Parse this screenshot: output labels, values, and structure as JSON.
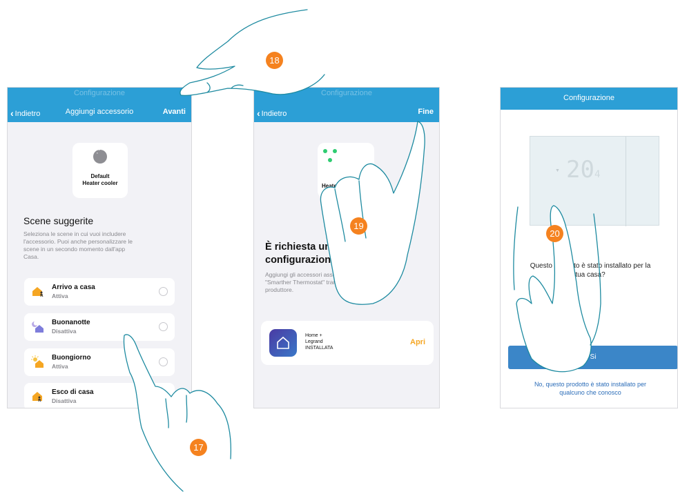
{
  "screen1": {
    "ghost_title": "Configurazione",
    "back_label": "Indietro",
    "title": "Aggiungi accessorio",
    "next_label": "Avanti",
    "accessory_lines": [
      "Default",
      "Heater cooler"
    ],
    "section_title": "Scene suggerite",
    "section_desc_lines": [
      "Seleziona le scene in cui vuoi includere",
      "l'accessorio. Puoi anche personalizzare le",
      "scene in un secondo momento dall'app",
      "Casa."
    ],
    "scenes": [
      {
        "name": "Arrivo a casa",
        "status": "Attiva",
        "icon": "house-arrive-icon"
      },
      {
        "name": "Buonanotte",
        "status": "Disattiva",
        "icon": "moon-house-icon"
      },
      {
        "name": "Buongiorno",
        "status": "Attiva",
        "icon": "sun-house-icon"
      },
      {
        "name": "Esco di casa",
        "status": "Disattiva",
        "icon": "house-leave-icon"
      }
    ]
  },
  "screen2": {
    "ghost_title": "Configurazione",
    "back_label": "Indietro",
    "done_label": "Fine",
    "accessory_label": "Heater",
    "heading_lines": [
      "È richiesta una procedura di",
      "configurazione aggiuntiva"
    ],
    "desc_lines": [
      "Aggiungi gli accessori associabili a",
      "\"Smarther Thermostat\" tramite l'app del",
      "produttore."
    ],
    "app_lines": [
      "Home +",
      "Legrand",
      "INSTALLATA"
    ],
    "open_label": "Apri"
  },
  "screen3": {
    "title": "Configurazione",
    "display_digits": "20",
    "display_small": "4",
    "question_lines": [
      "Questo prodotto è stato installato per la",
      "tua casa?"
    ],
    "yes_label": "Si",
    "alt_lines": [
      "No, questo prodotto è stato installato per",
      "qualcuno che conosco"
    ]
  },
  "steps": [
    "17",
    "18",
    "19",
    "20"
  ],
  "colors": {
    "nav_bar": "#2c9fd6",
    "primary_button": "#3b86c8",
    "step_badge": "#f5821f",
    "open_link": "#f5a623",
    "background": "#f2f2f6"
  }
}
